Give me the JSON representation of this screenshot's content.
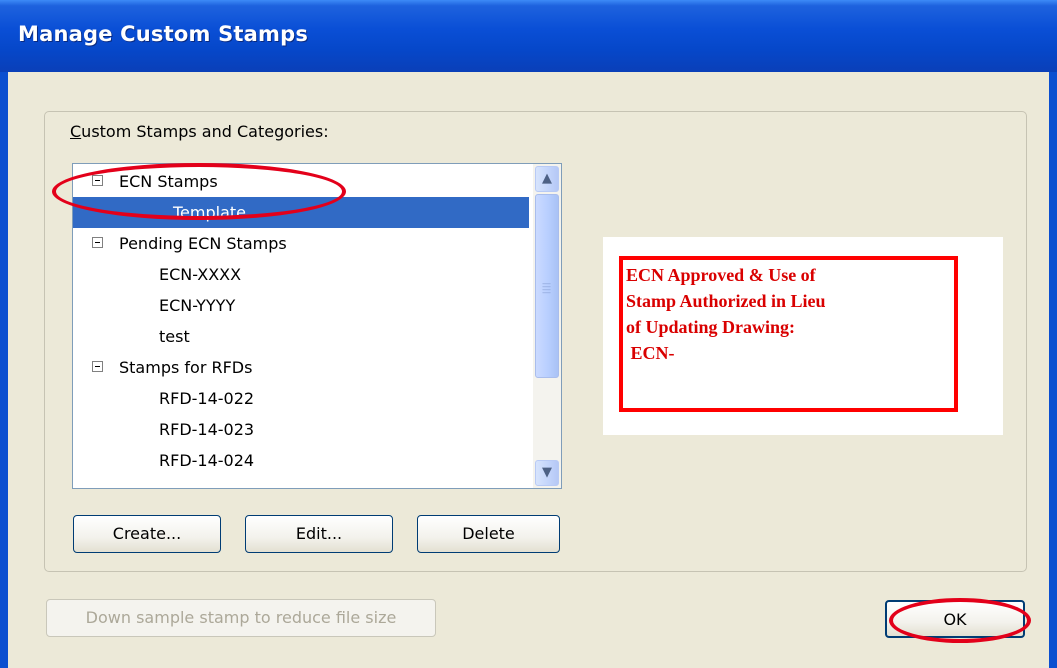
{
  "window": {
    "title": "Manage Custom Stamps"
  },
  "group": {
    "label": "Custom Stamps and Categories:",
    "mnemonic": "C"
  },
  "stamp_tree": [
    {
      "label": "ECN Stamps",
      "type": "category",
      "expanded": true
    },
    {
      "label": "Template",
      "type": "stamp",
      "selected": true
    },
    {
      "label": "Pending ECN Stamps",
      "type": "category",
      "expanded": true
    },
    {
      "label": "ECN-XXXX",
      "type": "stamp"
    },
    {
      "label": "ECN-YYYY",
      "type": "stamp"
    },
    {
      "label": "test",
      "type": "stamp"
    },
    {
      "label": "Stamps for RFDs",
      "type": "category",
      "expanded": true
    },
    {
      "label": "RFD-14-022",
      "type": "stamp"
    },
    {
      "label": "RFD-14-023",
      "type": "stamp"
    },
    {
      "label": "RFD-14-024",
      "type": "stamp"
    }
  ],
  "buttons": {
    "create": "Create...",
    "edit": "Edit...",
    "delete": "Delete",
    "downsample": "Down sample stamp to reduce file size",
    "ok": "OK"
  },
  "preview": {
    "lines": [
      "ECN Approved & Use of",
      "Stamp Authorized in Lieu",
      "of Updating Drawing:",
      " ECN-"
    ]
  },
  "scrollbar": {
    "up_icon": "chevron-up-icon",
    "down_icon": "chevron-down-icon"
  },
  "colors": {
    "titlebar": "#0a4fd6",
    "selection": "#316ac5",
    "stamp_red": "#d90000",
    "highlight": "#e3001a"
  }
}
